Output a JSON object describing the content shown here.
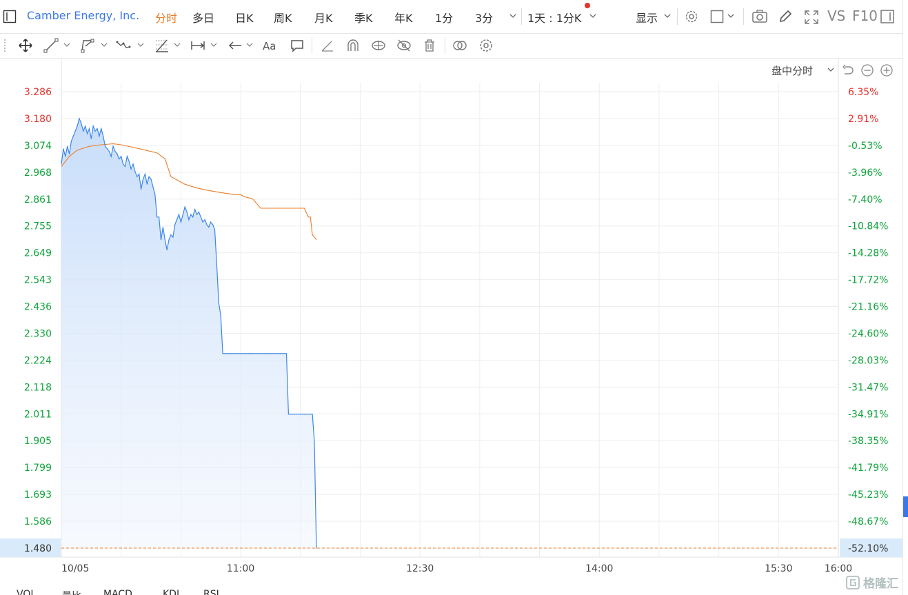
{
  "header": {
    "company": "Camber Energy, Inc.",
    "periods": [
      "分时",
      "多日",
      "日K",
      "周K",
      "月K",
      "季K",
      "年K",
      "1分",
      "3分"
    ],
    "active_period": 0,
    "interval": "1天 : 1分K",
    "display_label": "显示",
    "vs_label": "VS",
    "f10_label": "F10"
  },
  "subheader": {
    "mode_label": "盘中分时"
  },
  "bottom_tabs": [
    "VOL",
    "量比",
    "MACD",
    "KDJ",
    "RSI"
  ],
  "watermark": "格隆汇",
  "colors": {
    "up": "#e5322d",
    "down": "#0fa33b",
    "price_line": "#3b86e8",
    "avg_line": "#ec7c26",
    "active_tab": "#ec7c26",
    "brand_blue": "#3b78e7"
  },
  "chart_data": {
    "type": "area",
    "x_tick_labels": [
      "10/05",
      "11:00",
      "12:30",
      "14:00",
      "15:30",
      "16:00"
    ],
    "x_range": [
      "09:30",
      "16:00"
    ],
    "ylim": [
      1.48,
      3.286
    ],
    "y_tick_labels": [
      "3.286",
      "3.180",
      "3.074",
      "2.968",
      "2.861",
      "2.755",
      "2.649",
      "2.543",
      "2.436",
      "2.330",
      "2.224",
      "2.118",
      "2.011",
      "1.905",
      "1.799",
      "1.693",
      "1.586",
      "1.480"
    ],
    "pct_tick_labels": [
      "6.35%",
      "2.91%",
      "-0.53%",
      "-3.96%",
      "-7.40%",
      "-10.84%",
      "-14.28%",
      "-17.72%",
      "-21.16%",
      "-24.60%",
      "-28.03%",
      "-31.47%",
      "-34.91%",
      "-38.35%",
      "-41.79%",
      "-45.23%",
      "-48.67%",
      "-52.10%"
    ],
    "pct_positive_count": 2,
    "last_price": "1.480",
    "last_pct": "-52.10%",
    "series": [
      {
        "x": [
          "09:30",
          "09:31",
          "09:32",
          "09:33",
          "09:34",
          "09:35",
          "09:36",
          "09:37",
          "09:38",
          "09:39",
          "09:40",
          "09:41",
          "09:42",
          "09:43",
          "09:44",
          "09:45",
          "09:46",
          "09:47",
          "09:48",
          "09:49",
          "09:50",
          "09:51",
          "09:52",
          "09:53",
          "09:54",
          "09:55",
          "09:56",
          "09:57",
          "09:58",
          "09:59",
          "10:00",
          "10:01",
          "10:02",
          "10:03",
          "10:04",
          "10:05",
          "10:06",
          "10:07",
          "10:08",
          "10:09",
          "10:10",
          "10:11",
          "10:12",
          "10:13",
          "10:14",
          "10:15",
          "10:16",
          "10:17",
          "10:18",
          "10:19",
          "10:20",
          "10:21",
          "10:22",
          "10:23",
          "10:24",
          "10:25",
          "10:26",
          "10:27",
          "10:28",
          "10:29",
          "10:30",
          "10:31",
          "10:32",
          "10:33",
          "10:34",
          "10:35",
          "10:36",
          "10:37",
          "10:38",
          "10:39",
          "10:40",
          "10:41",
          "10:42",
          "10:43",
          "10:44",
          "10:45",
          "10:46",
          "10:47",
          "10:48",
          "10:49",
          "10:50",
          "10:51",
          "10:52",
          "10:53",
          "10:54",
          "10:55",
          "10:56",
          "10:57",
          "10:58",
          "10:59",
          "11:00",
          "11:01",
          "11:02",
          "11:03",
          "11:04",
          "11:05",
          "11:06",
          "11:07",
          "11:08",
          "11:09",
          "11:10",
          "11:11",
          "11:12",
          "11:13",
          "11:14",
          "11:15",
          "11:16",
          "11:17",
          "11:18",
          "11:19",
          "11:20",
          "11:21",
          "11:22",
          "11:23",
          "11:24",
          "11:25",
          "11:26",
          "11:27",
          "11:28",
          "11:29",
          "11:30",
          "11:31",
          "11:32",
          "11:33",
          "11:34",
          "11:35",
          "11:36",
          "11:37",
          "11:38"
        ],
        "values": [
          3.0,
          3.06,
          3.03,
          3.07,
          3.04,
          3.09,
          3.11,
          3.13,
          3.15,
          3.18,
          3.16,
          3.13,
          3.15,
          3.12,
          3.14,
          3.1,
          3.15,
          3.13,
          3.14,
          3.11,
          3.14,
          3.11,
          3.07,
          3.06,
          3.05,
          3.03,
          3.07,
          3.05,
          3.04,
          3.02,
          3.03,
          3.0,
          2.99,
          3.03,
          3.01,
          2.98,
          3.0,
          2.97,
          2.95,
          2.96,
          2.9,
          2.94,
          2.96,
          2.92,
          2.95,
          2.94,
          2.91,
          2.88,
          2.79,
          2.79,
          2.7,
          2.75,
          2.7,
          2.66,
          2.7,
          2.72,
          2.71,
          2.76,
          2.78,
          2.8,
          2.77,
          2.8,
          2.83,
          2.81,
          2.78,
          2.8,
          2.79,
          2.82,
          2.8,
          2.81,
          2.79,
          2.77,
          2.78,
          2.76,
          2.75,
          2.77,
          2.76,
          2.74,
          2.6,
          2.45,
          2.4,
          2.25,
          2.25,
          2.25,
          2.25,
          2.25,
          2.25,
          2.25,
          2.25,
          2.25,
          2.25,
          2.25,
          2.25,
          2.25,
          2.25,
          2.25,
          2.25,
          2.25,
          2.25,
          2.25,
          2.25,
          2.25,
          2.25,
          2.25,
          2.25,
          2.25,
          2.25,
          2.25,
          2.25,
          2.25,
          2.25,
          2.25,
          2.25,
          2.25,
          2.01,
          2.01,
          2.01,
          2.01,
          2.01,
          2.01,
          2.01,
          2.01,
          2.01,
          2.01,
          2.01,
          2.01,
          2.01,
          1.9,
          1.48
        ]
      },
      {
        "x": [
          "09:30",
          "09:34",
          "09:38",
          "09:44",
          "09:50",
          "09:56",
          "10:00",
          "10:06",
          "10:12",
          "10:18",
          "10:22",
          "10:25",
          "10:32",
          "10:38",
          "10:44",
          "10:50",
          "10:56",
          "11:00",
          "11:02",
          "11:06",
          "11:10",
          "11:16",
          "11:18",
          "11:21",
          "11:26",
          "11:32",
          "11:34",
          "11:35",
          "11:36",
          "11:38"
        ],
        "values": [
          2.99,
          3.03,
          3.055,
          3.07,
          3.076,
          3.08,
          3.076,
          3.066,
          3.055,
          3.044,
          3.02,
          2.95,
          2.92,
          2.905,
          2.895,
          2.887,
          2.88,
          2.878,
          2.87,
          2.862,
          2.825,
          2.825,
          2.825,
          2.825,
          2.825,
          2.825,
          2.79,
          2.79,
          2.72,
          2.7
        ]
      }
    ]
  }
}
